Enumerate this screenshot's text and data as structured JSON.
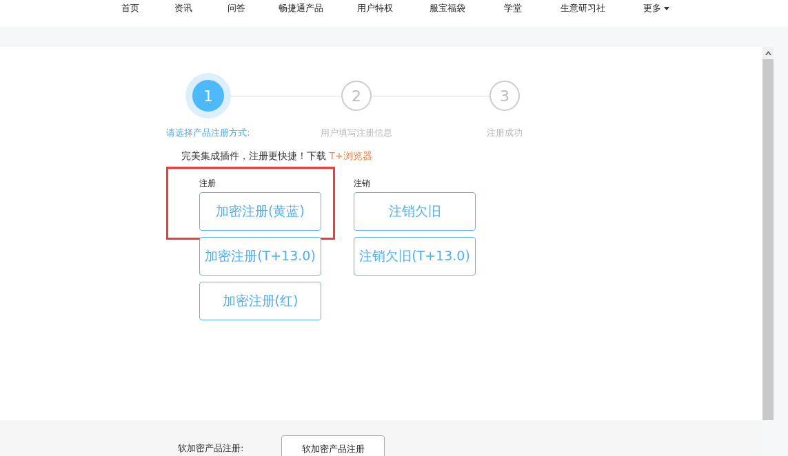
{
  "nav": [
    {
      "label": "首页"
    },
    {
      "label": "资讯"
    },
    {
      "label": "问答"
    },
    {
      "label": "畅捷通产品"
    },
    {
      "label": "用户特权"
    },
    {
      "label": "服宝福袋"
    },
    {
      "label": "学堂"
    },
    {
      "label": "生意研习社"
    },
    {
      "label": "更多",
      "dropdown": true
    }
  ],
  "steps": [
    {
      "number": "1",
      "label": "请选择产品注册方式:",
      "selected": true
    },
    {
      "number": "2",
      "label": "用户填写注册信息",
      "selected": false
    },
    {
      "number": "3",
      "label": "注册成功",
      "selected": false
    }
  ],
  "promo": {
    "text": "完美集成插件，注册更快捷！下载",
    "link": "T+浏览器"
  },
  "groups": [
    {
      "title": "注册",
      "buttons": [
        {
          "label": "加密注册(黄蓝)",
          "highlighted": true
        },
        {
          "label": "加密注册(T+13.0)",
          "highlighted": false
        },
        {
          "label": "加密注册(红)",
          "highlighted": false
        }
      ]
    },
    {
      "title": "注销",
      "buttons": [
        {
          "label": "注销欠旧",
          "highlighted": false
        },
        {
          "label": "注销欠旧(T+13.0)",
          "highlighted": false
        }
      ]
    }
  ],
  "footer": {
    "label": "软加密产品注册:",
    "button": "软加密产品注册"
  }
}
